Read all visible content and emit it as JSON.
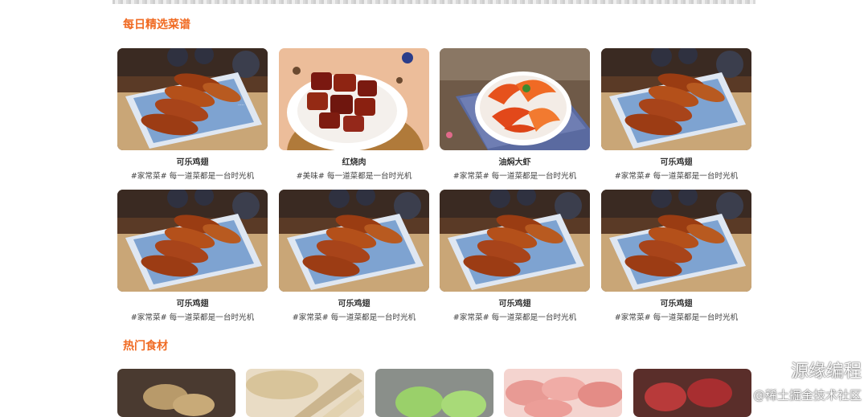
{
  "sections": {
    "daily": {
      "title": "每日精选菜谱"
    },
    "hot": {
      "title": "热门食材"
    }
  },
  "recipes": [
    {
      "title": "可乐鸡翅",
      "desc": "#家常菜# 每一道菜都是一台时光机",
      "image": "chicken-wings"
    },
    {
      "title": "红烧肉",
      "desc": "#美味# 每一道菜都是一台时光机",
      "image": "braised-pork"
    },
    {
      "title": "油焖大虾",
      "desc": "#家常菜# 每一道菜都是一台时光机",
      "image": "braised-shrimp"
    },
    {
      "title": "可乐鸡翅",
      "desc": "#家常菜# 每一道菜都是一台时光机",
      "image": "chicken-wings"
    },
    {
      "title": "可乐鸡翅",
      "desc": "#家常菜# 每一道菜都是一台时光机",
      "image": "chicken-wings"
    },
    {
      "title": "可乐鸡翅",
      "desc": "#家常菜# 每一道菜都是一台时光机",
      "image": "chicken-wings"
    },
    {
      "title": "可乐鸡翅",
      "desc": "#家常菜# 每一道菜都是一台时光机",
      "image": "chicken-wings"
    },
    {
      "title": "可乐鸡翅",
      "desc": "#家常菜# 每一道菜都是一台时光机",
      "image": "chicken-wings"
    }
  ],
  "ingredients": [
    {
      "image": "potato"
    },
    {
      "image": "yam"
    },
    {
      "image": "lettuce"
    },
    {
      "image": "sliced-meat"
    },
    {
      "image": "beef"
    }
  ],
  "watermark": {
    "line1": "源缘编程",
    "line2": "@稀土掘金技术社区",
    "icon": "wechat-icon"
  },
  "colors": {
    "accent": "#f06a22"
  }
}
